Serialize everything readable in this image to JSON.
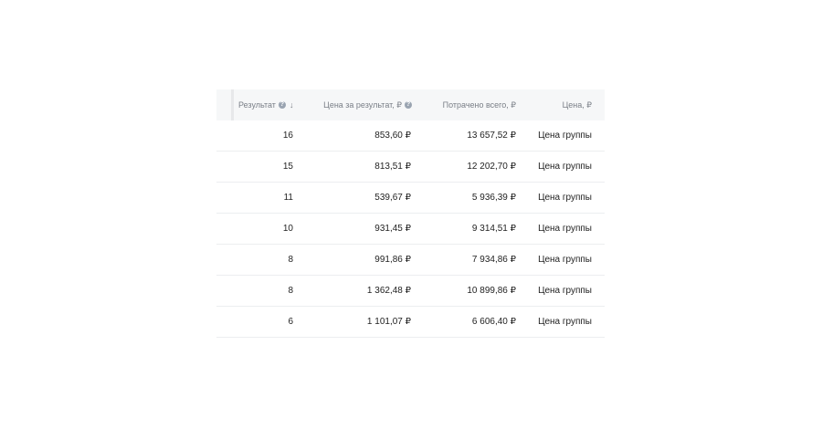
{
  "table": {
    "headers": {
      "result": "Результат",
      "cost_per_result": "Цена за результат, ₽",
      "spent_total": "Потрачено всего, ₽",
      "price": "Цена, ₽"
    },
    "rows": [
      {
        "result": "16",
        "cost_per_result": "853,60 ₽",
        "spent_total": "13 657,52 ₽",
        "price": "Цена группы"
      },
      {
        "result": "15",
        "cost_per_result": "813,51 ₽",
        "spent_total": "12 202,70 ₽",
        "price": "Цена группы"
      },
      {
        "result": "11",
        "cost_per_result": "539,67 ₽",
        "spent_total": "5 936,39 ₽",
        "price": "Цена группы"
      },
      {
        "result": "10",
        "cost_per_result": "931,45 ₽",
        "spent_total": "9 314,51 ₽",
        "price": "Цена группы"
      },
      {
        "result": "8",
        "cost_per_result": "991,86 ₽",
        "spent_total": "7 934,86 ₽",
        "price": "Цена группы"
      },
      {
        "result": "8",
        "cost_per_result": "1 362,48 ₽",
        "spent_total": "10 899,86 ₽",
        "price": "Цена группы"
      },
      {
        "result": "6",
        "cost_per_result": "1 101,07 ₽",
        "spent_total": "6 606,40 ₽",
        "price": "Цена группы"
      }
    ]
  },
  "icons": {
    "help": "?",
    "sort_desc": "↓"
  }
}
